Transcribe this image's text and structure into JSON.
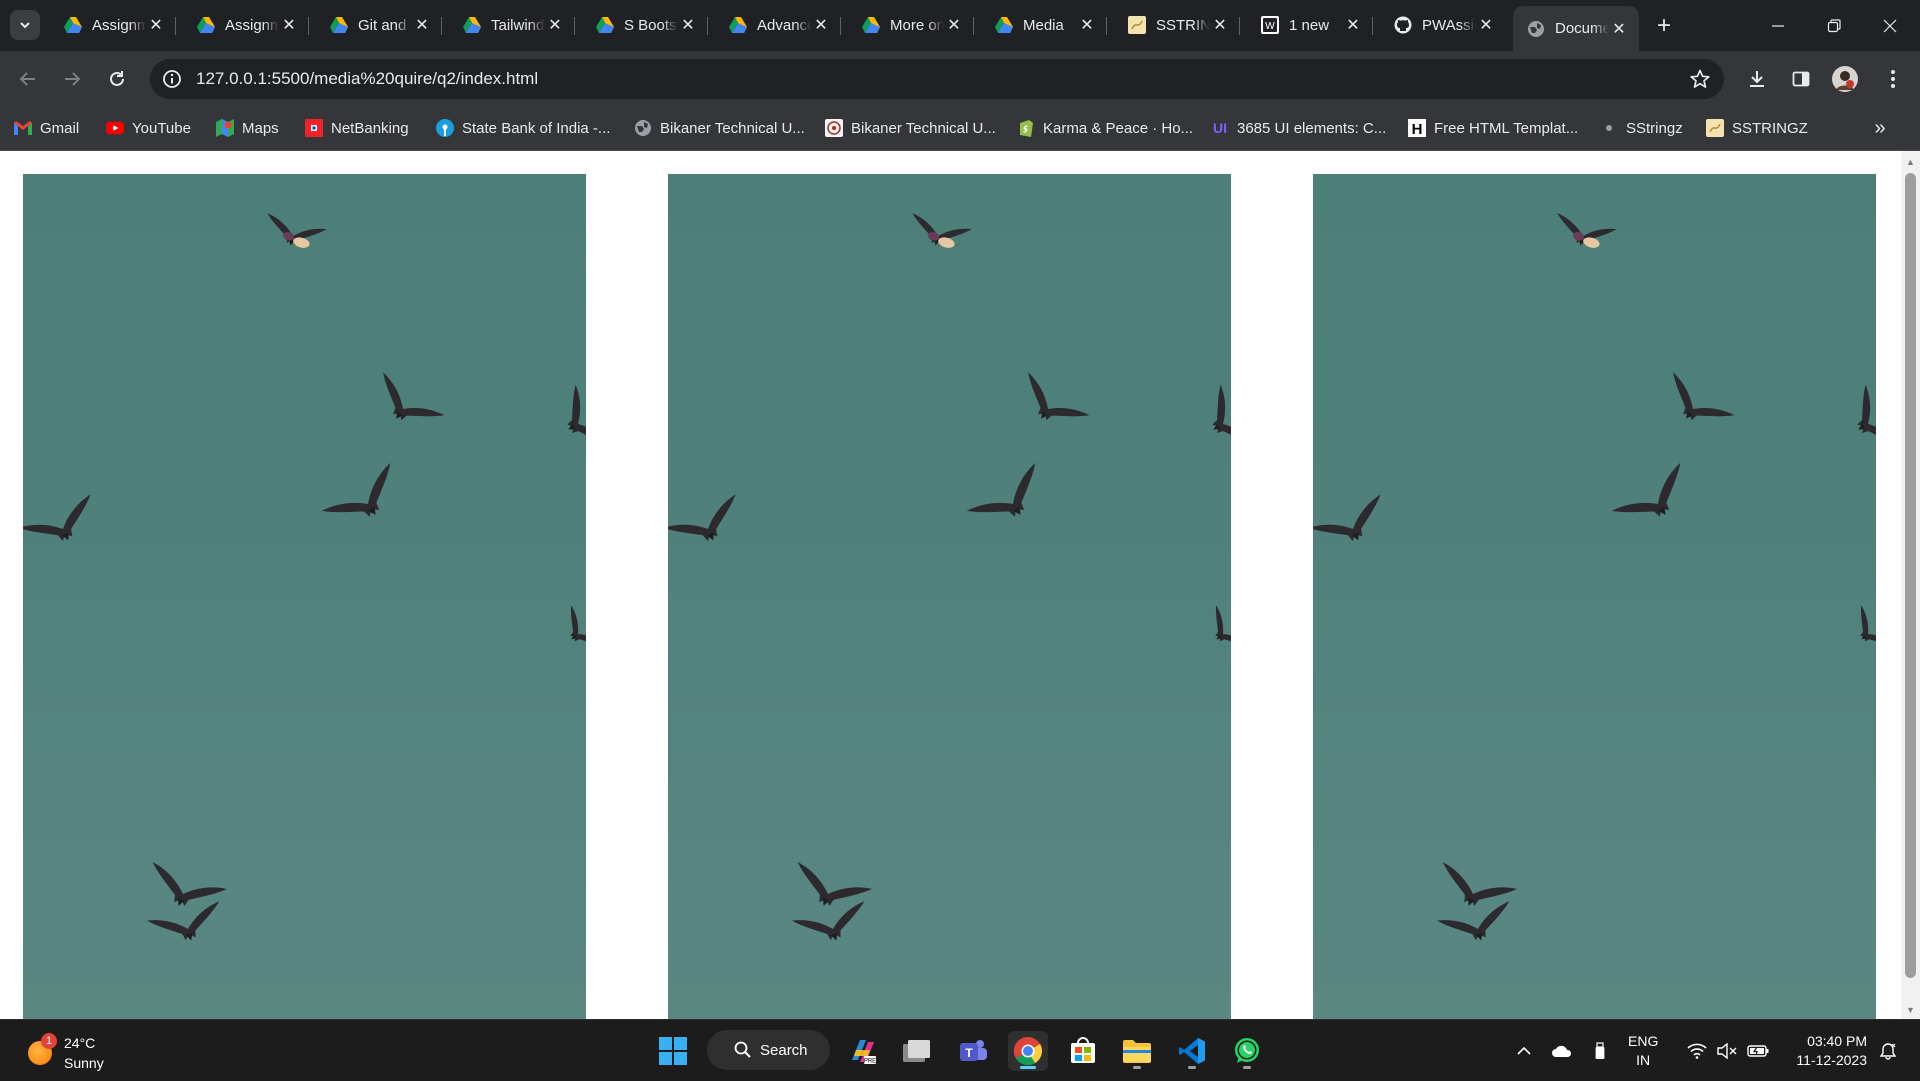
{
  "browser": {
    "tabs": [
      {
        "title": "Assignment",
        "favicon": "google-drive-icon",
        "active": false
      },
      {
        "title": "Assignment",
        "favicon": "google-drive-icon",
        "active": false
      },
      {
        "title": "Git and GitHub",
        "favicon": "google-drive-icon",
        "active": false
      },
      {
        "title": "Tailwind",
        "favicon": "google-drive-icon",
        "active": false
      },
      {
        "title": "S Bootstrap",
        "favicon": "google-drive-icon",
        "active": false
      },
      {
        "title": "Advanced",
        "favicon": "google-drive-icon",
        "active": false
      },
      {
        "title": "More on",
        "favicon": "google-drive-icon",
        "active": false
      },
      {
        "title": "Media",
        "favicon": "google-drive-icon",
        "active": false
      },
      {
        "title": "SSTRINGZ",
        "favicon": "sstringz-icon",
        "active": false
      },
      {
        "title": "1 new",
        "favicon": "wordpress-icon",
        "active": false
      },
      {
        "title": "PWAssign",
        "favicon": "github-icon",
        "active": false
      },
      {
        "title": "Document",
        "favicon": "globe-icon",
        "active": true
      }
    ],
    "new_tab_label": "+",
    "url": "127.0.0.1:5500/media%20quire/q2/index.html"
  },
  "bookmarks": [
    {
      "label": "Gmail",
      "icon": "gmail-icon"
    },
    {
      "label": "YouTube",
      "icon": "youtube-icon"
    },
    {
      "label": "Maps",
      "icon": "maps-icon"
    },
    {
      "label": "NetBanking",
      "icon": "netbanking-icon"
    },
    {
      "label": "State Bank of India -...",
      "icon": "sbi-icon"
    },
    {
      "label": "Bikaner Technical U...",
      "icon": "globe-icon"
    },
    {
      "label": "Bikaner Technical U...",
      "icon": "university-icon"
    },
    {
      "label": "Karma & Peace · Ho...",
      "icon": "shopify-icon"
    },
    {
      "label": "3685 UI elements: C...",
      "icon": "uiverse-icon"
    },
    {
      "label": "Free HTML Templat...",
      "icon": "h-icon"
    },
    {
      "label": "SStringz",
      "icon": "dot-icon"
    },
    {
      "label": "SSTRINGZ",
      "icon": "sstringz-icon"
    }
  ],
  "page": {
    "panels": [
      {
        "image": "birds-flying-sky-image"
      },
      {
        "image": "birds-flying-sky-image"
      },
      {
        "image": "birds-flying-sky-image"
      }
    ]
  },
  "taskbar": {
    "weather": {
      "badge": "1",
      "temp": "24°C",
      "condition": "Sunny"
    },
    "search_label": "Search",
    "apps": [
      "windows-start-icon",
      "copilot-icon",
      "file-explorer-window-icon",
      "teams-icon",
      "chrome-icon",
      "microsoft-store-icon",
      "folder-icon",
      "vscode-icon",
      "whatsapp-icon"
    ],
    "language": {
      "line1": "ENG",
      "line2": "IN"
    },
    "clock": {
      "time": "03:40 PM",
      "date": "11-12-2023"
    }
  },
  "colors": {
    "tabstrip_bg": "#202124",
    "toolbar_bg": "#35363a",
    "sky": "#4f807a",
    "taskbar_bg": "#1c1c1c"
  }
}
